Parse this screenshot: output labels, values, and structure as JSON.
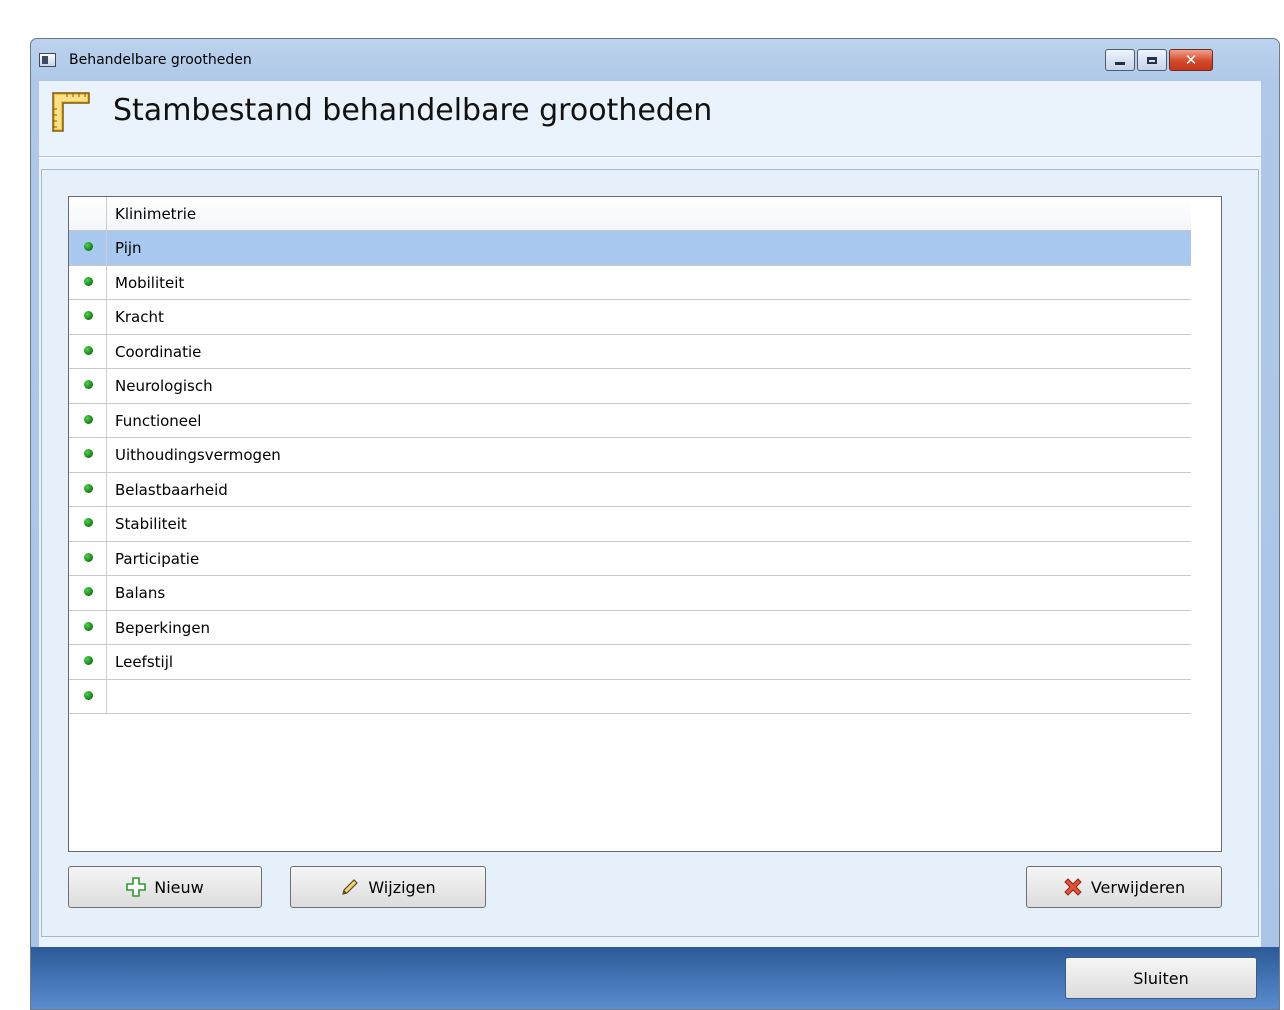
{
  "window": {
    "title": "Behandelbare grootheden",
    "controls": {
      "minimize_icon": "minimize-icon",
      "maximize_icon": "maximize-icon",
      "close_icon": "close-icon",
      "close_glyph": "✕"
    }
  },
  "header": {
    "title": "Stambestand behandelbare grootheden",
    "icon": "ruler-icon"
  },
  "grid": {
    "column_header": "Klinimetrie",
    "rows": [
      {
        "label": "Pijn",
        "selected": true
      },
      {
        "label": "Mobiliteit"
      },
      {
        "label": "Kracht"
      },
      {
        "label": "Coordinatie"
      },
      {
        "label": "Neurologisch"
      },
      {
        "label": "Functioneel"
      },
      {
        "label": "Uithoudingsvermogen"
      },
      {
        "label": "Belastbaarheid"
      },
      {
        "label": "Stabiliteit"
      },
      {
        "label": "Participatie"
      },
      {
        "label": "Balans"
      },
      {
        "label": "Beperkingen"
      },
      {
        "label": "Leefstijl"
      },
      {
        "label": ""
      }
    ],
    "status_color": "#1a8a1a",
    "selection_color": "#a9c9f0"
  },
  "buttons": {
    "new_label": "Nieuw",
    "edit_label": "Wijzigen",
    "delete_label": "Verwijderen",
    "close_label": "Sluiten",
    "new_icon": "plus-icon",
    "edit_icon": "pencil-icon",
    "delete_icon": "delete-icon"
  }
}
